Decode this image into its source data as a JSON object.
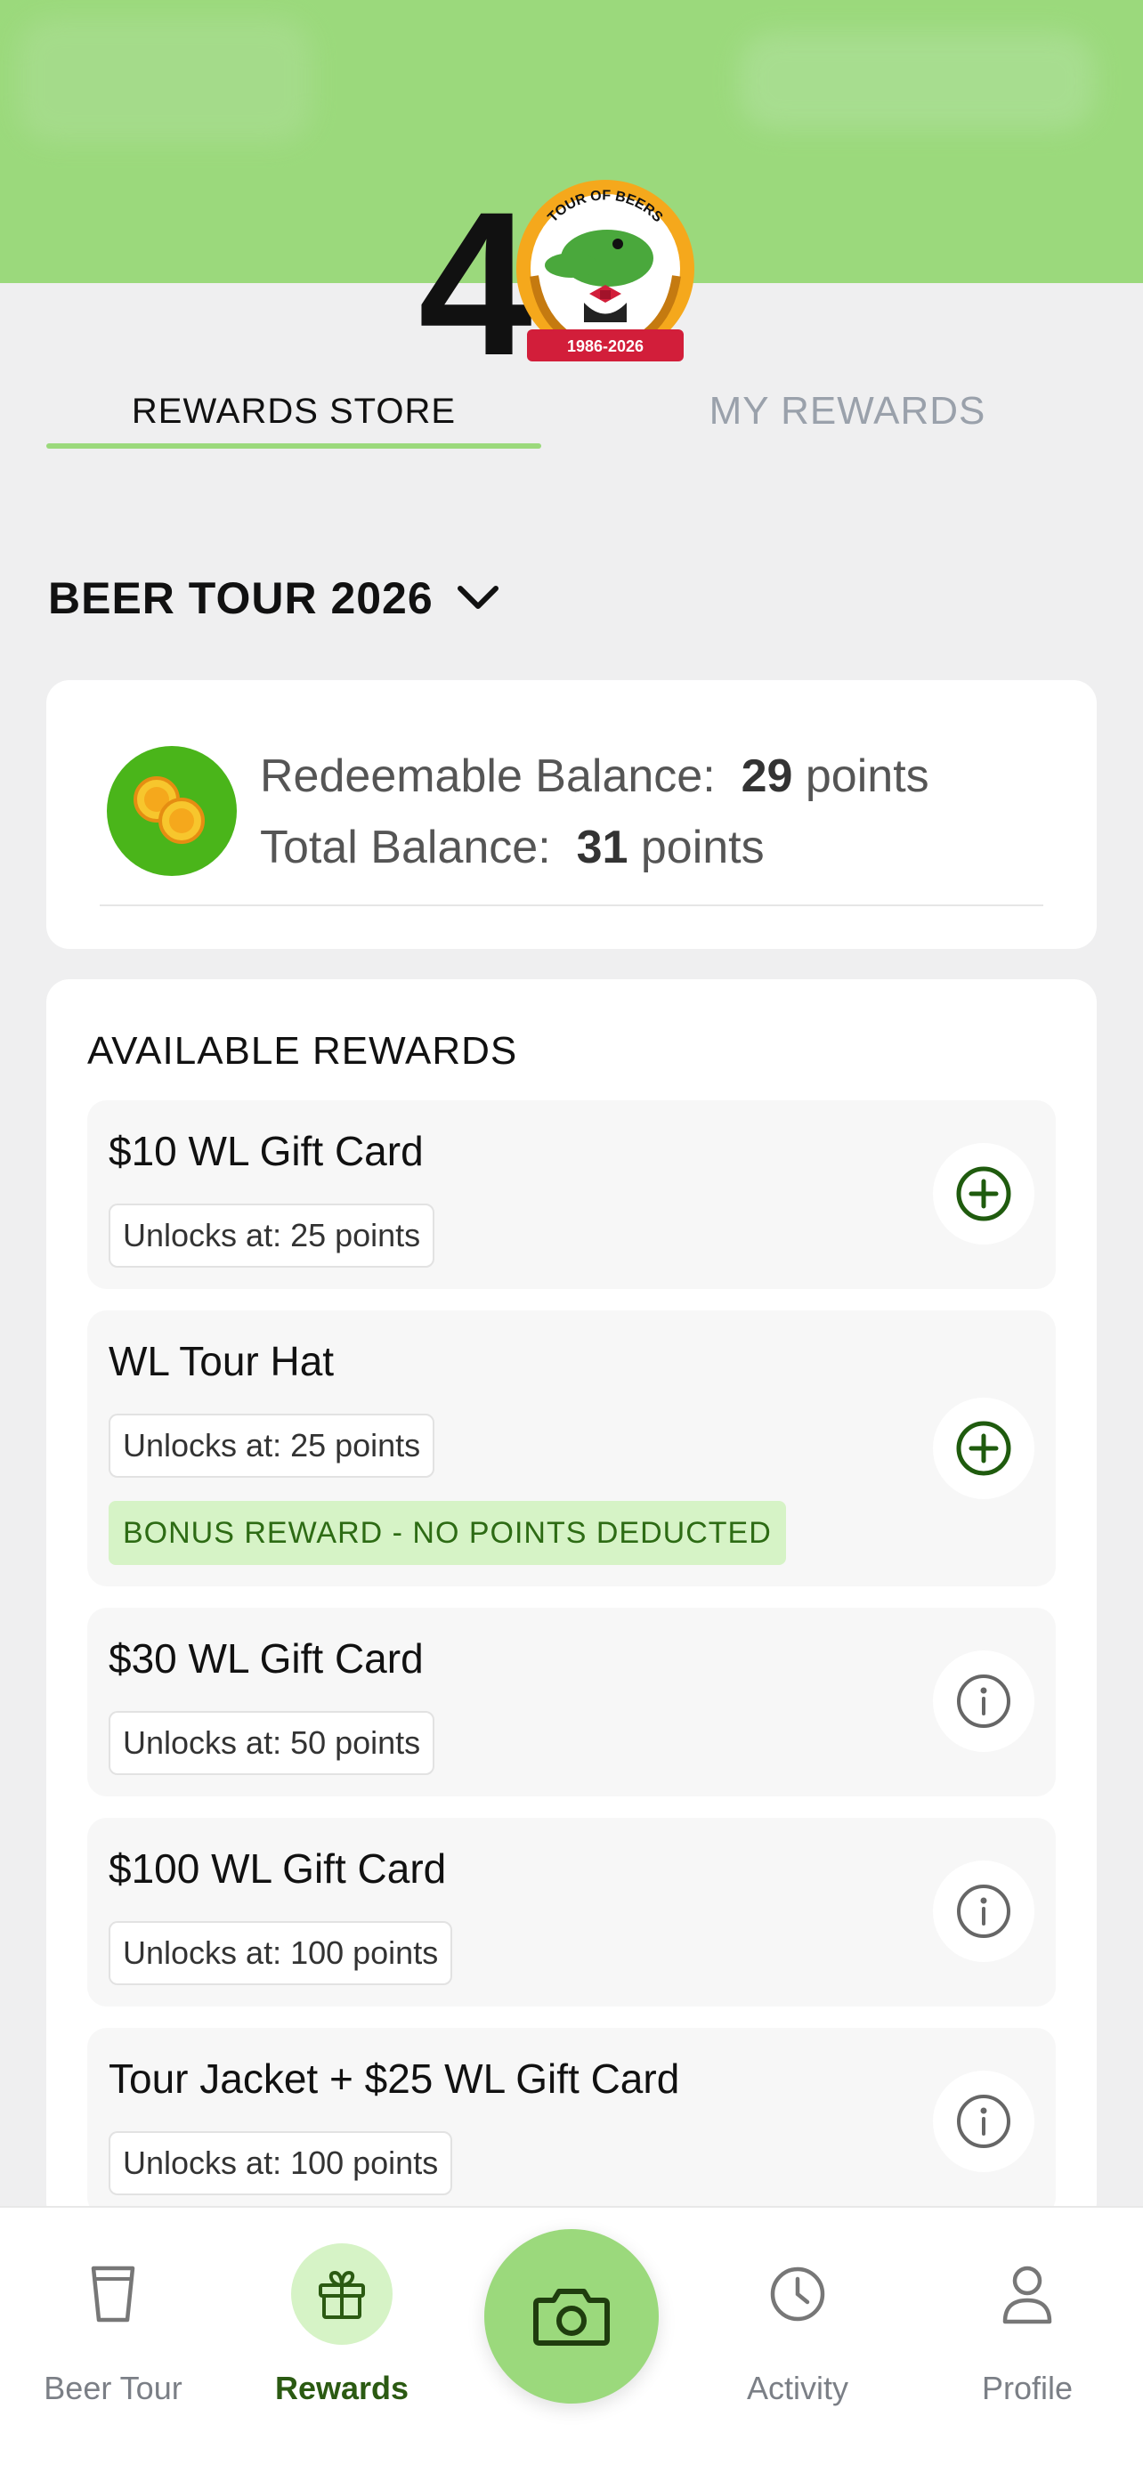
{
  "header": {
    "logo": {
      "number": "4",
      "badge_text": "TOUR OF BEERS",
      "badge_years": "1986-2026"
    }
  },
  "tabs": {
    "rewards_store": "REWARDS STORE",
    "my_rewards": "MY REWARDS",
    "active": "rewards_store"
  },
  "season": {
    "label": "BEER TOUR 2026"
  },
  "balance": {
    "redeemable_label": "Redeemable Balance:",
    "redeemable_value": "29",
    "total_label": "Total Balance:",
    "total_value": "31",
    "unit": "points"
  },
  "rewards": {
    "title": "AVAILABLE REWARDS",
    "items": [
      {
        "name": "$10 WL Gift Card",
        "unlock": "Unlocks at: 25 points",
        "bonus": "",
        "action": "add-icon"
      },
      {
        "name": "WL Tour Hat",
        "unlock": "Unlocks at: 25 points",
        "bonus": "BONUS REWARD - NO POINTS DEDUCTED",
        "action": "add-icon"
      },
      {
        "name": "$30 WL Gift Card",
        "unlock": "Unlocks at: 50 points",
        "bonus": "",
        "action": "info-icon"
      },
      {
        "name": "$100 WL Gift Card",
        "unlock": "Unlocks at: 100 points",
        "bonus": "",
        "action": "info-icon"
      },
      {
        "name": "Tour Jacket + $25 WL Gift Card",
        "unlock": "Unlocks at: 100 points",
        "bonus": "",
        "action": "info-icon"
      }
    ]
  },
  "nav": {
    "items": [
      {
        "label": "Beer Tour",
        "icon": "cup-icon"
      },
      {
        "label": "Rewards",
        "icon": "gift-icon"
      },
      {
        "label": "",
        "icon": "camera-icon"
      },
      {
        "label": "Activity",
        "icon": "clock-icon"
      },
      {
        "label": "Profile",
        "icon": "person-icon"
      }
    ],
    "active": "Rewards"
  },
  "colors": {
    "brand_green": "#9bd97c",
    "accent_dark_green": "#2b5a12",
    "bonus_bg": "#d6f3c6"
  }
}
